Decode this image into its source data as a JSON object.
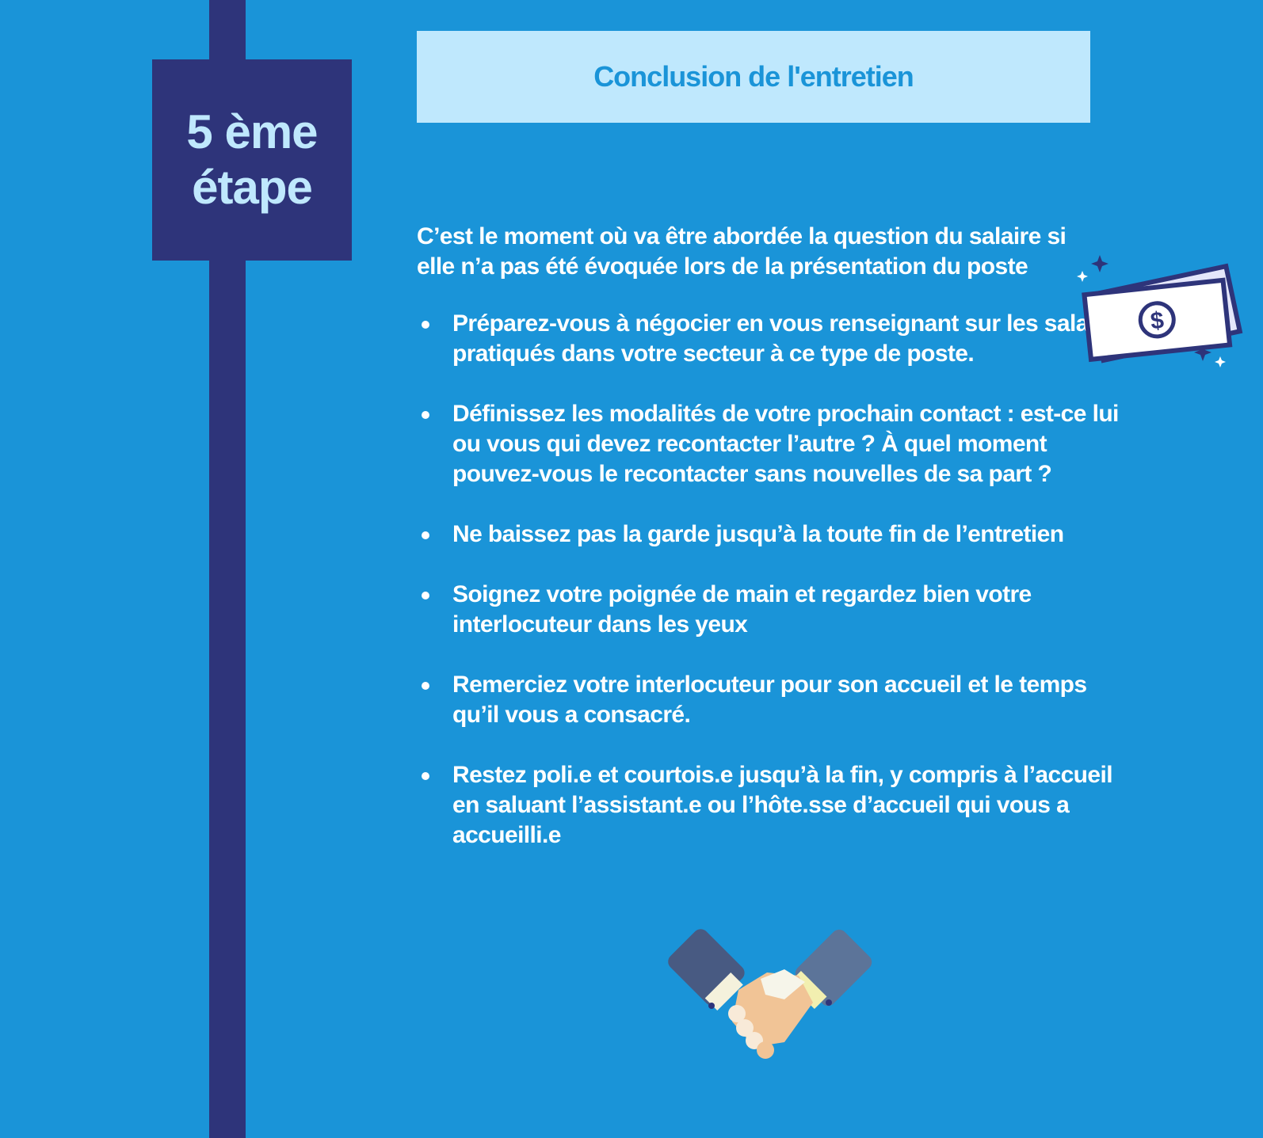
{
  "step": {
    "line1": "5 ème",
    "line2": "étape"
  },
  "title": "Conclusion de l'entretien",
  "intro": "C’est le moment où va être abordée la question du salaire si elle n’a pas été évoquée lors de la présentation du poste",
  "bullets": [
    "Préparez-vous à négocier en vous renseignant sur les salaires pratiqués dans votre secteur à ce type de poste.",
    "Définissez les modalités de votre prochain contact : est-ce lui ou vous qui devez recontacter l’autre ?  À quel moment pouvez-vous le recontacter sans nouvelles de sa part ?",
    "Ne baissez pas la garde jusqu’à la toute fin de l’entretien",
    "Soignez votre poignée de main et regardez bien votre interlocuteur dans les yeux",
    "Remerciez votre interlocuteur pour son accueil et le temps qu’il vous a consacré.",
    "Restez poli.e et courtois.e jusqu’à la fin, y compris à l’accueil en saluant l’assistant.e ou l’hôte.sse d’accueil qui vous a accueilli.e"
  ],
  "icons": {
    "money": "money-bill-icon",
    "handshake": "handshake-icon"
  },
  "colors": {
    "background": "#1a94d8",
    "navy": "#2e347a",
    "light_blue": "#bfe8fd"
  }
}
